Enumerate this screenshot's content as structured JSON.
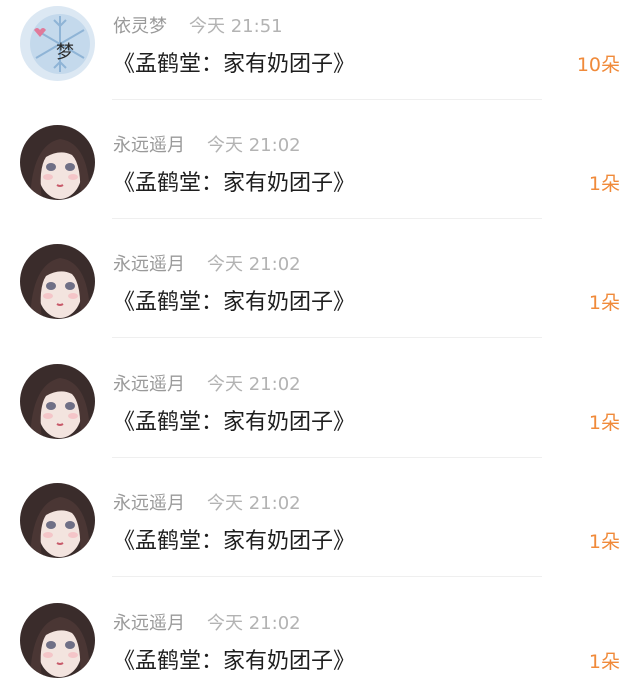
{
  "comments": [
    {
      "username": "依灵梦",
      "time": "今天 21:51",
      "title": "《孟鹤堂：家有奶团子》",
      "count": "10朵",
      "avatar": "snowflake-avatar",
      "avatar_glyph": "梦"
    },
    {
      "username": "永远遥月",
      "time": "今天 21:02",
      "title": "《孟鹤堂：家有奶团子》",
      "count": "1朵",
      "avatar": "anime-girl-avatar"
    },
    {
      "username": "永远遥月",
      "time": "今天 21:02",
      "title": "《孟鹤堂：家有奶团子》",
      "count": "1朵",
      "avatar": "anime-girl-avatar"
    },
    {
      "username": "永远遥月",
      "time": "今天 21:02",
      "title": "《孟鹤堂：家有奶团子》",
      "count": "1朵",
      "avatar": "anime-girl-avatar"
    },
    {
      "username": "永远遥月",
      "time": "今天 21:02",
      "title": "《孟鹤堂：家有奶团子》",
      "count": "1朵",
      "avatar": "anime-girl-avatar"
    },
    {
      "username": "永远遥月",
      "time": "今天 21:02",
      "title": "《孟鹤堂：家有奶团子》",
      "count": "1朵",
      "avatar": "anime-girl-avatar"
    }
  ],
  "colors": {
    "accent_count": "#f08a3a",
    "username": "#9a9a9a",
    "timestamp": "#b3b3b3",
    "title_text": "#1e1e1e",
    "divider": "#efefef"
  }
}
